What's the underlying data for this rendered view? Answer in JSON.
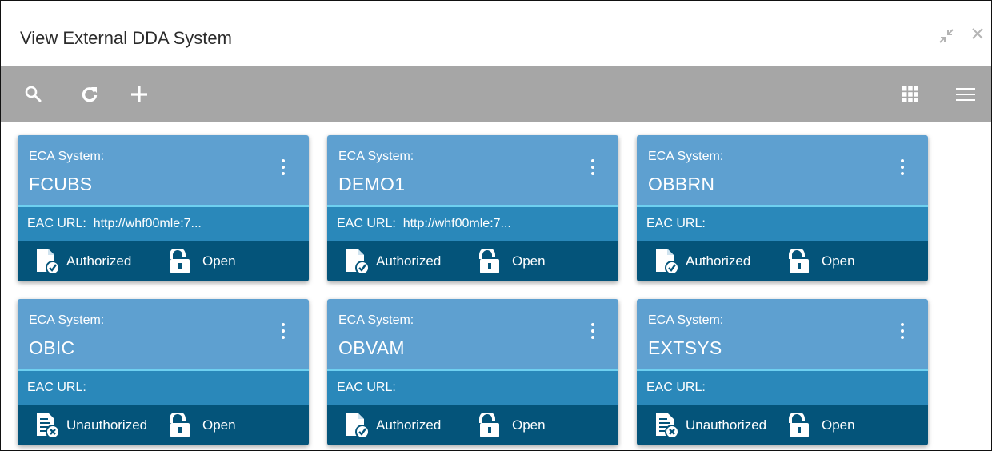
{
  "window": {
    "title": "View External DDA System",
    "minimize_icon": "collapse-arrows-icon",
    "close_icon": "close-icon"
  },
  "toolbar": {
    "search_icon": "search-icon",
    "refresh_icon": "refresh-icon",
    "add_icon": "plus-icon",
    "grid_view_icon": "grid-view-icon",
    "list_view_icon": "list-view-icon"
  },
  "colors": {
    "toolbar_bg": "#a6a6a6",
    "card_top": "#5ea0d0",
    "card_url": "#2a88ba",
    "card_footer": "#04547a",
    "accent_line": "#6ed0f0"
  },
  "cards": [
    {
      "label": "ECA System:",
      "name": "FCUBS",
      "url_label": "EAC URL:",
      "url_value": "http://whf00mle:7...",
      "auth_status": "Authorized",
      "auth_icon": "authorized-doc-icon",
      "record_status": "Open",
      "record_icon": "unlock-icon"
    },
    {
      "label": "ECA System:",
      "name": "DEMO1",
      "url_label": "EAC URL:",
      "url_value": "http://whf00mle:7...",
      "auth_status": "Authorized",
      "auth_icon": "authorized-doc-icon",
      "record_status": "Open",
      "record_icon": "unlock-icon"
    },
    {
      "label": "ECA System:",
      "name": "OBBRN",
      "url_label": "EAC URL:",
      "url_value": "",
      "auth_status": "Authorized",
      "auth_icon": "authorized-doc-icon",
      "record_status": "Open",
      "record_icon": "unlock-icon"
    },
    {
      "label": "ECA System:",
      "name": "OBIC",
      "url_label": "EAC URL:",
      "url_value": "",
      "auth_status": "Unauthorized",
      "auth_icon": "unauthorized-doc-icon",
      "record_status": "Open",
      "record_icon": "unlock-icon"
    },
    {
      "label": "ECA System:",
      "name": "OBVAM",
      "url_label": "EAC URL:",
      "url_value": "",
      "auth_status": "Authorized",
      "auth_icon": "authorized-doc-icon",
      "record_status": "Open",
      "record_icon": "unlock-icon"
    },
    {
      "label": "ECA System:",
      "name": "EXTSYS",
      "url_label": "EAC URL:",
      "url_value": "",
      "auth_status": "Unauthorized",
      "auth_icon": "unauthorized-doc-icon",
      "record_status": "Open",
      "record_icon": "unlock-icon"
    }
  ]
}
